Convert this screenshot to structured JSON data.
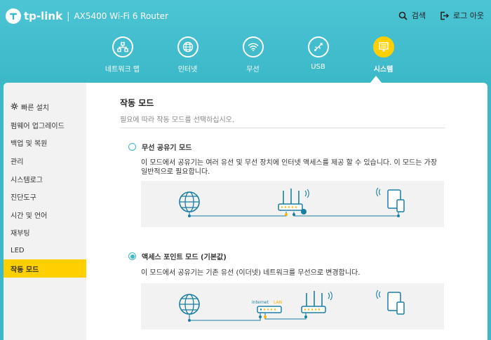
{
  "brand": {
    "name": "tp-link",
    "separator": "|",
    "product": "AX5400 Wi-Fi 6 Router"
  },
  "header_actions": [
    {
      "label": "검색",
      "icon": "search-icon"
    },
    {
      "label": "로그 아웃",
      "icon": "logout-icon"
    }
  ],
  "nav": [
    {
      "label": "네트워크 맵",
      "icon": "network-map-icon"
    },
    {
      "label": "인터넷",
      "icon": "globe-icon"
    },
    {
      "label": "무선",
      "icon": "wifi-icon"
    },
    {
      "label": "USB",
      "icon": "usb-icon"
    },
    {
      "label": "시스템",
      "icon": "system-icon",
      "active": true
    }
  ],
  "sidebar": [
    {
      "label": "빠른 설치",
      "icon": "gear-icon"
    },
    {
      "label": "펌웨어 업그레이드"
    },
    {
      "label": "백업 및 복원"
    },
    {
      "label": "관리"
    },
    {
      "label": "시스템로그"
    },
    {
      "label": "진단도구"
    },
    {
      "label": "시간 및 언어"
    },
    {
      "label": "재부팅"
    },
    {
      "label": "LED"
    },
    {
      "label": "작동 모드",
      "active": true
    }
  ],
  "main": {
    "title": "작동 모드",
    "subtitle": "필요에 따라 작동 모드를 선택하십시오.",
    "options": [
      {
        "label": "무선 공유기 모드",
        "selected": false,
        "description": "이 모드에서 공유기는 여러 유선 및 무선 장치에 인터넷 액세스를 제공 할 수 있습니다. 이 모드는 가장 일반적으로 필요합니다."
      },
      {
        "label": "액세스 포인트 모드 (기본값)",
        "selected": true,
        "description": "이 모드에서 공유기는 기존 유선 (이더넷) 네트워크를 무선으로 변경합니다.",
        "diagram_labels": {
          "internet": "Internet",
          "lan": "LAN"
        }
      }
    ]
  },
  "colors": {
    "accent": "#3cb9c9",
    "active": "#ffcf00",
    "panel": "#f2f2f2"
  }
}
